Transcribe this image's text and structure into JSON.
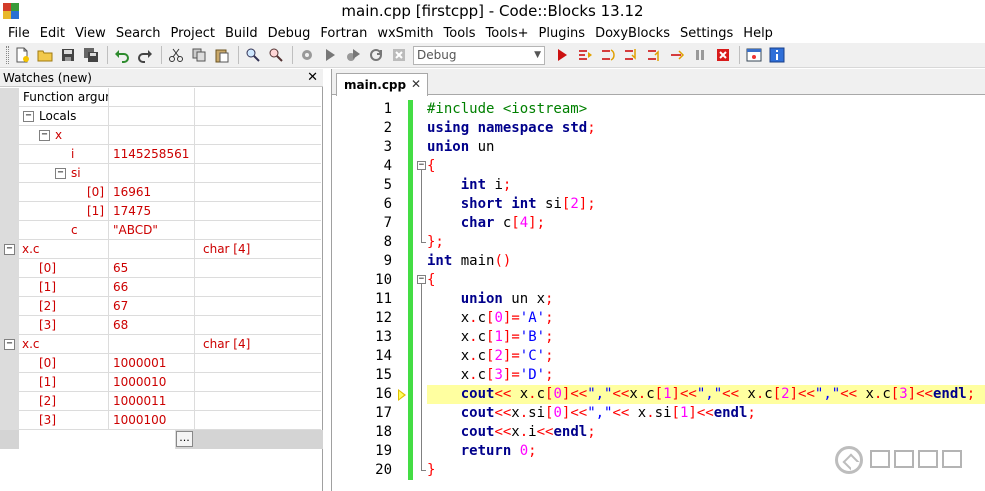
{
  "window": {
    "title": "main.cpp [firstcpp] - Code::Blocks 13.12"
  },
  "menu": [
    "File",
    "Edit",
    "View",
    "Search",
    "Project",
    "Build",
    "Debug",
    "Fortran",
    "wxSmith",
    "Tools",
    "Tools+",
    "Plugins",
    "DoxyBlocks",
    "Settings",
    "Help"
  ],
  "toolbar": {
    "build_target": "Debug"
  },
  "watches": {
    "title": "Watches (new)",
    "close": "✕",
    "rows": [
      {
        "indent": 0,
        "toggle": "",
        "name": "Function argum",
        "value": "",
        "type": "",
        "red": false
      },
      {
        "indent": 0,
        "toggle": "−",
        "name": "Locals",
        "value": "",
        "type": "",
        "red": false
      },
      {
        "indent": 1,
        "toggle": "−",
        "name": "x",
        "value": "",
        "type": "",
        "red": true
      },
      {
        "indent": 3,
        "toggle": "",
        "name": "i",
        "value": "1145258561",
        "type": "",
        "red": true
      },
      {
        "indent": 2,
        "toggle": "−",
        "name": "si",
        "value": "",
        "type": "",
        "red": true
      },
      {
        "indent": 4,
        "toggle": "",
        "name": "[0]",
        "value": "16961",
        "type": "",
        "red": true
      },
      {
        "indent": 4,
        "toggle": "",
        "name": "[1]",
        "value": "17475",
        "type": "",
        "red": true
      },
      {
        "indent": 3,
        "toggle": "",
        "name": "c",
        "value": "\"ABCD\"",
        "type": "",
        "red": true
      },
      {
        "indent": -1,
        "toggle": "−",
        "name": "x.c",
        "value": "",
        "type": "char [4]",
        "red": true
      },
      {
        "indent": 1,
        "toggle": "",
        "name": "[0]",
        "value": "65",
        "type": "",
        "red": true
      },
      {
        "indent": 1,
        "toggle": "",
        "name": "[1]",
        "value": "66",
        "type": "",
        "red": true
      },
      {
        "indent": 1,
        "toggle": "",
        "name": "[2]",
        "value": "67",
        "type": "",
        "red": true
      },
      {
        "indent": 1,
        "toggle": "",
        "name": "[3]",
        "value": "68",
        "type": "",
        "red": true
      },
      {
        "indent": -1,
        "toggle": "−",
        "name": "x.c",
        "value": "",
        "type": "char [4]",
        "red": true
      },
      {
        "indent": 1,
        "toggle": "",
        "name": "[0]",
        "value": "1000001",
        "type": "",
        "red": true
      },
      {
        "indent": 1,
        "toggle": "",
        "name": "[1]",
        "value": "1000010",
        "type": "",
        "red": true
      },
      {
        "indent": 1,
        "toggle": "",
        "name": "[2]",
        "value": "1000011",
        "type": "",
        "red": true
      },
      {
        "indent": 1,
        "toggle": "",
        "name": "[3]",
        "value": "1000100",
        "type": "",
        "red": true
      }
    ],
    "add_button": "..."
  },
  "editor": {
    "tab_label": "main.cpp",
    "tab_close": "✕",
    "current_line": 16,
    "lines": [
      [
        [
          "pp",
          "#include <iostream>"
        ]
      ],
      [
        [
          "kw",
          "using"
        ],
        [
          "id",
          " "
        ],
        [
          "kw",
          "namespace"
        ],
        [
          "id",
          " "
        ],
        [
          "kw",
          "std"
        ],
        [
          "op",
          ";"
        ]
      ],
      [
        [
          "kw",
          "union"
        ],
        [
          "id",
          " un"
        ]
      ],
      [
        [
          "op",
          "{"
        ]
      ],
      [
        [
          "id",
          "    "
        ],
        [
          "kw",
          "int"
        ],
        [
          "id",
          " i"
        ],
        [
          "op",
          ";"
        ]
      ],
      [
        [
          "id",
          "    "
        ],
        [
          "kw",
          "short"
        ],
        [
          "id",
          " "
        ],
        [
          "kw",
          "int"
        ],
        [
          "id",
          " si"
        ],
        [
          "op",
          "["
        ],
        [
          "num",
          "2"
        ],
        [
          "op",
          "];"
        ]
      ],
      [
        [
          "id",
          "    "
        ],
        [
          "kw",
          "char"
        ],
        [
          "id",
          " c"
        ],
        [
          "op",
          "["
        ],
        [
          "num",
          "4"
        ],
        [
          "op",
          "];"
        ]
      ],
      [
        [
          "op",
          "};"
        ]
      ],
      [
        [
          "kw",
          "int"
        ],
        [
          "id",
          " main"
        ],
        [
          "op",
          "()"
        ]
      ],
      [
        [
          "op",
          "{"
        ]
      ],
      [
        [
          "id",
          "    "
        ],
        [
          "kw",
          "union"
        ],
        [
          "id",
          " un x"
        ],
        [
          "op",
          ";"
        ]
      ],
      [
        [
          "id",
          "    x"
        ],
        [
          "op",
          "."
        ],
        [
          "id",
          "c"
        ],
        [
          "op",
          "["
        ],
        [
          "num",
          "0"
        ],
        [
          "op",
          "]="
        ],
        [
          "str",
          "'A'"
        ],
        [
          "op",
          ";"
        ]
      ],
      [
        [
          "id",
          "    x"
        ],
        [
          "op",
          "."
        ],
        [
          "id",
          "c"
        ],
        [
          "op",
          "["
        ],
        [
          "num",
          "1"
        ],
        [
          "op",
          "]="
        ],
        [
          "str",
          "'B'"
        ],
        [
          "op",
          ";"
        ]
      ],
      [
        [
          "id",
          "    x"
        ],
        [
          "op",
          "."
        ],
        [
          "id",
          "c"
        ],
        [
          "op",
          "["
        ],
        [
          "num",
          "2"
        ],
        [
          "op",
          "]="
        ],
        [
          "str",
          "'C'"
        ],
        [
          "op",
          ";"
        ]
      ],
      [
        [
          "id",
          "    x"
        ],
        [
          "op",
          "."
        ],
        [
          "id",
          "c"
        ],
        [
          "op",
          "["
        ],
        [
          "num",
          "3"
        ],
        [
          "op",
          "]="
        ],
        [
          "str",
          "'D'"
        ],
        [
          "op",
          ";"
        ]
      ],
      [
        [
          "id",
          "    "
        ],
        [
          "kw",
          "cout"
        ],
        [
          "op",
          "<<"
        ],
        [
          "id",
          " x"
        ],
        [
          "op",
          "."
        ],
        [
          "id",
          "c"
        ],
        [
          "op",
          "["
        ],
        [
          "num",
          "0"
        ],
        [
          "op",
          "]<<"
        ],
        [
          "str",
          "\",\""
        ],
        [
          "op",
          "<<"
        ],
        [
          "id",
          "x"
        ],
        [
          "op",
          "."
        ],
        [
          "id",
          "c"
        ],
        [
          "op",
          "["
        ],
        [
          "num",
          "1"
        ],
        [
          "op",
          "]<<"
        ],
        [
          "str",
          "\",\""
        ],
        [
          "op",
          "<<"
        ],
        [
          "id",
          " x"
        ],
        [
          "op",
          "."
        ],
        [
          "id",
          "c"
        ],
        [
          "op",
          "["
        ],
        [
          "num",
          "2"
        ],
        [
          "op",
          "]<<"
        ],
        [
          "str",
          "\",\""
        ],
        [
          "op",
          "<<"
        ],
        [
          "id",
          " x"
        ],
        [
          "op",
          "."
        ],
        [
          "id",
          "c"
        ],
        [
          "op",
          "["
        ],
        [
          "num",
          "3"
        ],
        [
          "op",
          "]<<"
        ],
        [
          "kw",
          "endl"
        ],
        [
          "op",
          ";"
        ]
      ],
      [
        [
          "id",
          "    "
        ],
        [
          "kw",
          "cout"
        ],
        [
          "op",
          "<<"
        ],
        [
          "id",
          "x"
        ],
        [
          "op",
          "."
        ],
        [
          "id",
          "si"
        ],
        [
          "op",
          "["
        ],
        [
          "num",
          "0"
        ],
        [
          "op",
          "]<<"
        ],
        [
          "str",
          "\",\""
        ],
        [
          "op",
          "<<"
        ],
        [
          "id",
          " x"
        ],
        [
          "op",
          "."
        ],
        [
          "id",
          "si"
        ],
        [
          "op",
          "["
        ],
        [
          "num",
          "1"
        ],
        [
          "op",
          "]<<"
        ],
        [
          "kw",
          "endl"
        ],
        [
          "op",
          ";"
        ]
      ],
      [
        [
          "id",
          "    "
        ],
        [
          "kw",
          "cout"
        ],
        [
          "op",
          "<<"
        ],
        [
          "id",
          "x"
        ],
        [
          "op",
          "."
        ],
        [
          "id",
          "i"
        ],
        [
          "op",
          "<<"
        ],
        [
          "kw",
          "endl"
        ],
        [
          "op",
          ";"
        ]
      ],
      [
        [
          "id",
          "    "
        ],
        [
          "kw",
          "return"
        ],
        [
          "id",
          " "
        ],
        [
          "num",
          "0"
        ],
        [
          "op",
          ";"
        ]
      ],
      [
        [
          "op",
          "}"
        ]
      ]
    ],
    "folds": [
      "",
      "",
      "",
      "open",
      "line",
      "line",
      "line",
      "end",
      "",
      "open",
      "line",
      "line",
      "line",
      "line",
      "line",
      "line",
      "line",
      "line",
      "line",
      "end"
    ]
  },
  "colors": {
    "keyword": "#00008b",
    "preprocessor": "#008000",
    "operator": "#ff0000",
    "string": "#0000ff",
    "number": "#ff00ff",
    "current_line": "#ffffa0",
    "change_bar": "#44dd44"
  }
}
